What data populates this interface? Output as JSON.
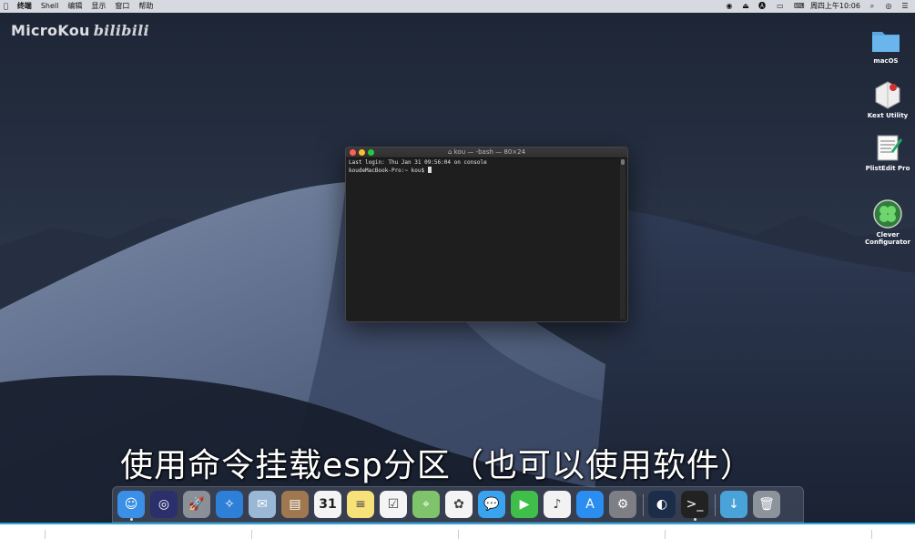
{
  "menubar": {
    "apple": "",
    "items": [
      "终端",
      "Shell",
      "编辑",
      "显示",
      "窗口",
      "帮助"
    ],
    "clock": "周四上午10:06",
    "status_icons": [
      "record-icon",
      "eject-icon",
      "input-source-icon",
      "battery-icon",
      "keyboard-icon",
      "search-icon",
      "siri-icon",
      "menu-list-icon"
    ]
  },
  "watermark": {
    "brand": "MicroKou",
    "site": "bilibili"
  },
  "desktop_icons": [
    {
      "label": "macOS",
      "icon": "folder-icon"
    },
    {
      "label": "Kext Utility",
      "icon": "kext-utility-icon"
    },
    {
      "label": "PlistEdit Pro",
      "icon": "plistedit-icon"
    },
    {
      "label": "Clever\nConfigurator",
      "icon": "clover-icon"
    }
  ],
  "terminal": {
    "title": "kou — -bash — 80×24",
    "lines": [
      "Last login: Thu Jan 31 09:56:04 on console",
      "koudeMacBook-Pro:~ kou$ "
    ]
  },
  "subtitle": "使用命令挂载esp分区（也可以使用软件）",
  "dock": {
    "apps": [
      {
        "name": "Finder",
        "icon": "finder-icon",
        "color": "#3a8fe6",
        "running": true
      },
      {
        "name": "Siri",
        "icon": "siri-icon",
        "color": "#2b2f6b",
        "running": false
      },
      {
        "name": "Launchpad",
        "icon": "rocket-icon",
        "color": "#8a8f98",
        "running": false
      },
      {
        "name": "Safari",
        "icon": "safari-icon",
        "color": "#2e7fd8",
        "running": false
      },
      {
        "name": "Mail",
        "icon": "mail-icon",
        "color": "#9ab8d6",
        "running": false
      },
      {
        "name": "Contacts",
        "icon": "contacts-icon",
        "color": "#a07850",
        "running": false
      },
      {
        "name": "Calendar",
        "icon": "calendar-icon",
        "color": "#f4f4f4",
        "running": false
      },
      {
        "name": "Notes",
        "icon": "notes-icon",
        "color": "#f7e27a",
        "running": false
      },
      {
        "name": "Reminders",
        "icon": "reminders-icon",
        "color": "#f4f4f4",
        "running": false
      },
      {
        "name": "Maps",
        "icon": "maps-icon",
        "color": "#7fc46a",
        "running": false
      },
      {
        "name": "Photos",
        "icon": "photos-icon",
        "color": "#f4f4f4",
        "running": false
      },
      {
        "name": "Messages",
        "icon": "messages-icon",
        "color": "#3aa3f0",
        "running": false
      },
      {
        "name": "FaceTime",
        "icon": "facetime-icon",
        "color": "#3fbf4a",
        "running": false
      },
      {
        "name": "iTunes",
        "icon": "itunes-icon",
        "color": "#f2f2f2",
        "running": false
      },
      {
        "name": "App Store",
        "icon": "app-store-icon",
        "color": "#2b8df0",
        "running": false
      },
      {
        "name": "System Preferences",
        "icon": "gear-icon",
        "color": "#7d7f85",
        "running": false
      }
    ],
    "recent": [
      {
        "name": "Hackintosh tool",
        "icon": "swirl-icon",
        "color": "#1c2d4a",
        "running": false
      },
      {
        "name": "Terminal",
        "icon": "terminal-icon",
        "color": "#222222",
        "running": true
      }
    ],
    "right": [
      {
        "name": "Downloads",
        "icon": "downloads-folder-icon",
        "color": "#4aa3d8"
      },
      {
        "name": "Trash",
        "icon": "trash-icon",
        "color": "#8d939b"
      }
    ],
    "calendar_day": "31"
  },
  "progress": {
    "fraction": 1.0,
    "color": "#2aa7e0"
  },
  "colors": {
    "menubar": "#e6e8ee",
    "terminal_bg": "#1e1e1e",
    "close": "#ff5f57",
    "minimize": "#febc2e",
    "zoom": "#28c840"
  }
}
